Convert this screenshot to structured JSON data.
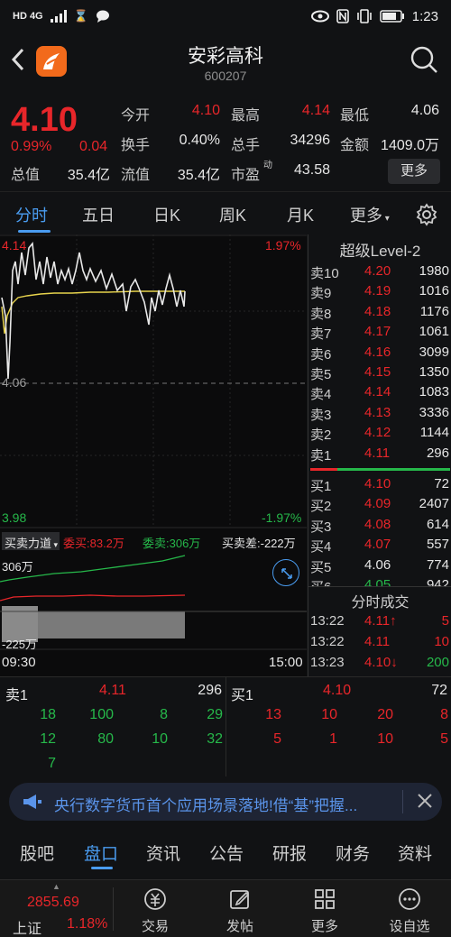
{
  "status_bar": {
    "signal": "HD 4G",
    "time": "1:23"
  },
  "header": {
    "title": "安彩高科",
    "code": "600207"
  },
  "quote": {
    "price": "4.10",
    "pct": "0.99%",
    "change": "0.04",
    "fields": [
      {
        "label": "今开",
        "value": "4.10",
        "color": "#e8262a"
      },
      {
        "label": "最高",
        "value": "4.14",
        "color": "#e8262a"
      },
      {
        "label": "最低",
        "value": "4.06",
        "color": "#e6e6e6"
      },
      {
        "label": "换手",
        "value": "0.40%",
        "color": "#e6e6e6"
      },
      {
        "label": "总手",
        "value": "34296",
        "color": "#e6e6e6"
      },
      {
        "label": "金额",
        "value": "1409.0万",
        "color": "#e6e6e6"
      },
      {
        "label": "总值",
        "value": "35.4亿",
        "color": "#e6e6e6"
      },
      {
        "label": "流值",
        "value": "35.4亿",
        "color": "#e6e6e6"
      },
      {
        "label": "市盈",
        "value": "43.58",
        "color": "#e6e6e6",
        "sup": "动"
      }
    ],
    "more": "更多"
  },
  "tabs": [
    "分时",
    "五日",
    "日K",
    "周K",
    "月K",
    "更多"
  ],
  "chart": {
    "top_price": "4.14",
    "top_pct": "1.97%",
    "mid_price": "4.06",
    "bottom_price": "3.98",
    "bottom_pct": "-1.97%",
    "indicator": "买卖力道",
    "buy_label": "委买:83.2万",
    "sell_label": "委卖:306万",
    "diff_label": "买卖差:-222万",
    "sub_top": "306万",
    "sub_bottom": "-225万",
    "time_start": "09:30",
    "time_end": "15:00"
  },
  "chart_data": {
    "type": "line",
    "title": "",
    "ylim": [
      3.98,
      4.14
    ],
    "x": [
      "09:30",
      "15:00"
    ],
    "series": []
  },
  "book": {
    "title": "超级Level-2",
    "asks": [
      {
        "k": "卖10",
        "p": "4.20",
        "v": "1980",
        "c": "#e8262a"
      },
      {
        "k": "卖9",
        "p": "4.19",
        "v": "1016",
        "c": "#e8262a"
      },
      {
        "k": "卖8",
        "p": "4.18",
        "v": "1176",
        "c": "#e8262a"
      },
      {
        "k": "卖7",
        "p": "4.17",
        "v": "1061",
        "c": "#e8262a"
      },
      {
        "k": "卖6",
        "p": "4.16",
        "v": "3099",
        "c": "#e8262a"
      },
      {
        "k": "卖5",
        "p": "4.15",
        "v": "1350",
        "c": "#e8262a"
      },
      {
        "k": "卖4",
        "p": "4.14",
        "v": "1083",
        "c": "#e8262a"
      },
      {
        "k": "卖3",
        "p": "4.13",
        "v": "3336",
        "c": "#e8262a"
      },
      {
        "k": "卖2",
        "p": "4.12",
        "v": "1144",
        "c": "#e8262a"
      },
      {
        "k": "卖1",
        "p": "4.11",
        "v": "296",
        "c": "#e8262a"
      }
    ],
    "bids": [
      {
        "k": "买1",
        "p": "4.10",
        "v": "72",
        "c": "#e8262a"
      },
      {
        "k": "买2",
        "p": "4.09",
        "v": "2407",
        "c": "#e8262a"
      },
      {
        "k": "买3",
        "p": "4.08",
        "v": "614",
        "c": "#e8262a"
      },
      {
        "k": "买4",
        "p": "4.07",
        "v": "557",
        "c": "#e8262a"
      },
      {
        "k": "买5",
        "p": "4.06",
        "v": "774",
        "c": "#e6e6e6"
      },
      {
        "k": "买6",
        "p": "4.05",
        "v": "942",
        "c": "#26b84a"
      }
    ],
    "trades_title": "分时成交",
    "trades": [
      {
        "t": "13:22",
        "p": "4.11↑",
        "v": "5",
        "pc": "#e8262a",
        "vc": "#e8262a"
      },
      {
        "t": "13:22",
        "p": "4.11",
        "v": "10",
        "pc": "#e8262a",
        "vc": "#e8262a"
      },
      {
        "t": "13:23",
        "p": "4.10↓",
        "v": "200",
        "pc": "#e8262a",
        "vc": "#26b84a"
      }
    ]
  },
  "summary": {
    "left_head": {
      "k": "卖1",
      "p": "4.11",
      "v": "296"
    },
    "right_head": {
      "k": "买1",
      "p": "4.10",
      "v": "72"
    },
    "left_rows": [
      [
        "18",
        "100",
        "8",
        "29"
      ],
      [
        "12",
        "80",
        "10",
        "32"
      ],
      [
        "7",
        "",
        "",
        ""
      ]
    ],
    "right_rows": [
      [
        "13",
        "10",
        "20",
        "8"
      ],
      [
        "5",
        "1",
        "10",
        "5"
      ]
    ]
  },
  "news": {
    "text": "央行数字货币首个应用场景落地!借“基”把握..."
  },
  "subtabs": [
    "股吧",
    "盘口",
    "资讯",
    "公告",
    "研报",
    "财务",
    "资料"
  ],
  "bottom_nav": {
    "index_value": "2855.69",
    "index_name": "上证",
    "index_pct": "1.18%",
    "items": [
      "交易",
      "发帖",
      "更多",
      "设自选"
    ]
  }
}
